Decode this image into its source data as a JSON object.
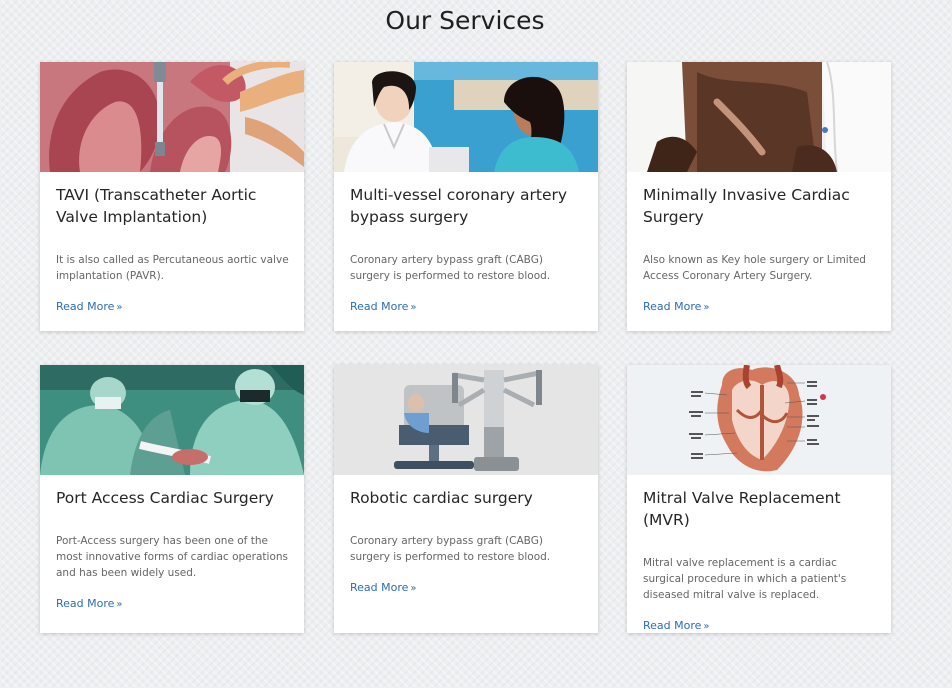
{
  "page": {
    "title": "Our Services"
  },
  "services": [
    {
      "title": "TAVI (Transcatheter Aortic Valve Implantation)",
      "description": "It is also called as Percutaneous aortic valve implantation (PAVR).",
      "link": "Read More"
    },
    {
      "title": "Multi-vessel coronary artery bypass surgery",
      "description": "Coronary artery bypass graft (CABG) surgery is performed to restore blood.",
      "link": "Read More"
    },
    {
      "title": "Minimally Invasive Cardiac Surgery",
      "description": "Also known as Key hole surgery or Limited Access Coronary Artery Surgery.",
      "link": "Read More"
    },
    {
      "title": "Port Access Cardiac Surgery",
      "description": "Port-Access surgery has been one of the most innovative forms of cardiac operations and has been widely used.",
      "link": "Read More"
    },
    {
      "title": "Robotic cardiac surgery",
      "description": "Coronary artery bypass graft (CABG) surgery is performed to restore blood.",
      "link": "Read More"
    },
    {
      "title": "Mitral Valve Replacement (MVR)",
      "description": "Mitral valve replacement is a cardiac surgical procedure in which a patient's diseased mitral valve is replaced.",
      "link": "Read More"
    }
  ],
  "icons": {
    "read_more": "chevron-double-right-icon"
  },
  "colors": {
    "link": "#2b6cb4",
    "title": "#262626",
    "text": "#666666"
  }
}
